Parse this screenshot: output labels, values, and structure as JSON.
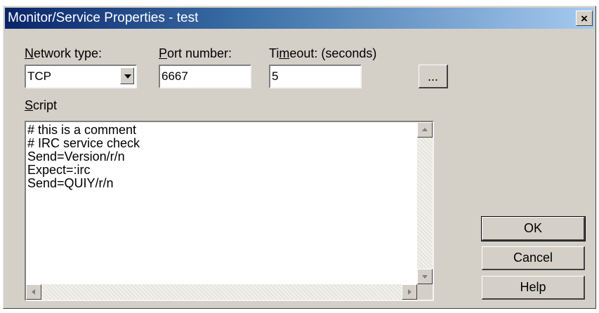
{
  "window": {
    "title": "Monitor/Service Properties - test",
    "close_glyph": "×"
  },
  "network_type": {
    "label_key": "N",
    "label_rest": "etwork type:",
    "value": "TCP"
  },
  "port_number": {
    "label_key": "P",
    "label_rest": "ort number:",
    "value": "6667"
  },
  "timeout": {
    "label_pre": "Ti",
    "label_key": "m",
    "label_rest": "eout: (seconds)",
    "value": "5"
  },
  "browse_button": {
    "label": "..."
  },
  "script": {
    "label_key": "S",
    "label_rest": "cript",
    "text": "# this is a comment\n# IRC service check\nSend=Version/r/n\nExpect=:irc\nSend=QUIY/r/n"
  },
  "buttons": {
    "ok": "OK",
    "cancel": "Cancel",
    "help": "Help"
  }
}
